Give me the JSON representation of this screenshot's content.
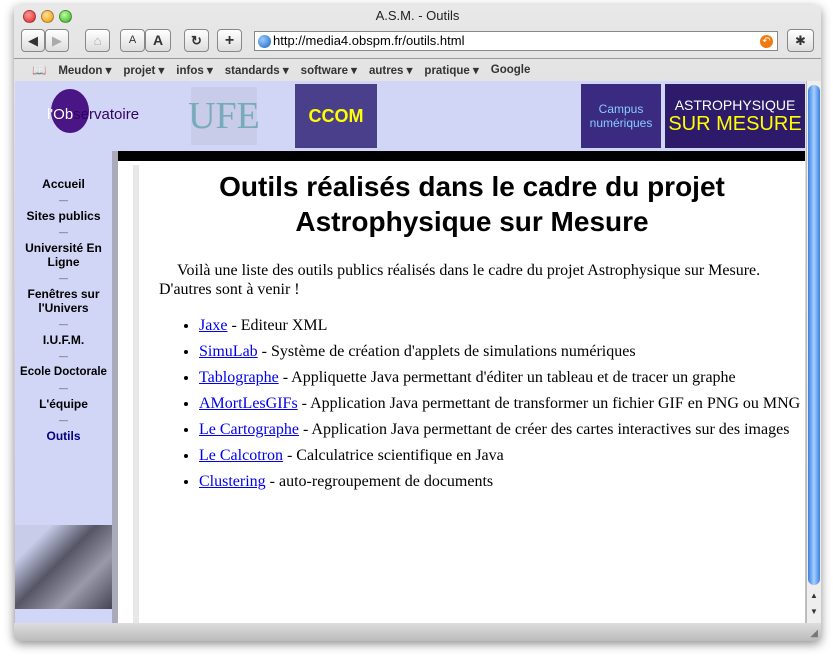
{
  "window": {
    "title": "A.S.M. - Outils"
  },
  "toolbar": {
    "back": "◀",
    "forward": "▶",
    "home": "⌂",
    "text_small": "A",
    "text_large": "A",
    "reload": "↻",
    "add": "+",
    "bug": "✱",
    "url": "http://media4.obspm.fr/outils.html"
  },
  "bookmarks": {
    "icon": "book-icon",
    "items": [
      "Meudon ▾",
      "projet ▾",
      "infos ▾",
      "standards ▾",
      "software ▾",
      "autres ▾",
      "pratique ▾",
      "Google"
    ]
  },
  "header": {
    "logos": [
      "l'Observatoire de Paris",
      "UFE",
      "Centre de Création d'Outils MultiMédias",
      "Campus numériques",
      "Astrophysique sur Mesure"
    ]
  },
  "sidebar": {
    "items": [
      "Accueil",
      "Sites publics",
      "Université En Ligne",
      "Fenêtres sur l'Univers",
      "I.U.F.M.",
      "Ecole Doctorale",
      "L'équipe",
      "Outils"
    ],
    "active": "Outils"
  },
  "main": {
    "title": "Outils réalisés dans le cadre du projet Astrophysique sur Mesure",
    "intro": "Voilà une liste des outils publics réalisés dans le cadre du projet Astrophysique sur Mesure. D'autres sont à venir !",
    "tools": [
      {
        "name": "Jaxe",
        "desc": " - Editeur XML"
      },
      {
        "name": "SimuLab",
        "desc": " - Système de création d'applets de simulations numériques"
      },
      {
        "name": "Tablographe",
        "desc": " - Appliquette Java permettant d'éditer un tableau et de tracer un graphe"
      },
      {
        "name": "AMortLesGIFs",
        "desc": " - Application Java permettant de transformer un fichier GIF en PNG ou MNG"
      },
      {
        "name": "Le Cartographe",
        "desc": " - Application Java permettant de créer des cartes interactives sur des images"
      },
      {
        "name": "Le Calcotron",
        "desc": " - Calculatrice scientifique en Java"
      },
      {
        "name": "Clustering",
        "desc": " - auto-regroupement de documents"
      }
    ]
  },
  "colors": {
    "header_bg": "#d2d6f6",
    "link": "#0000ee",
    "active_nav": "#000080"
  }
}
